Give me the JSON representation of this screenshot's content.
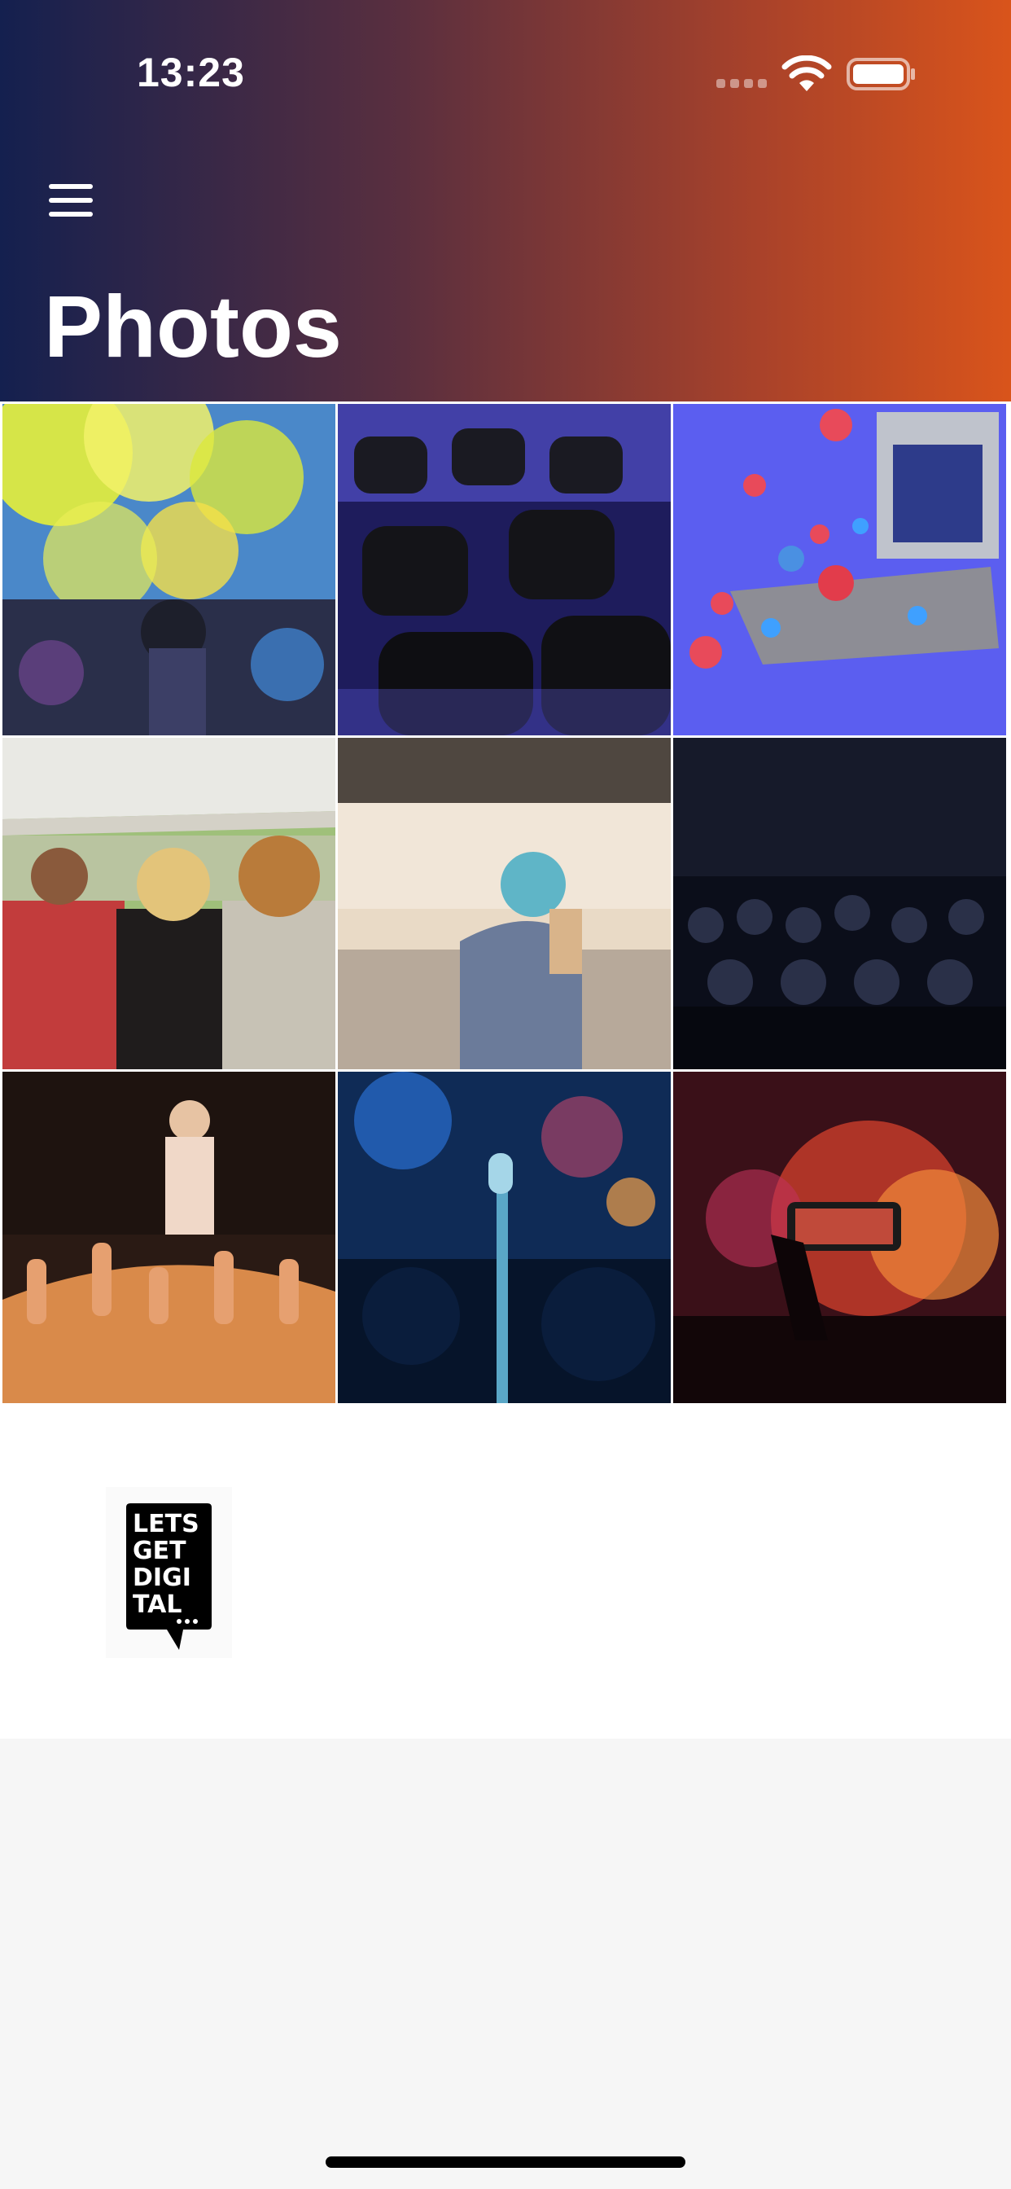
{
  "status_bar": {
    "time": "13:23",
    "icons": [
      "signal-dots-icon",
      "wifi-icon",
      "battery-icon"
    ]
  },
  "header": {
    "menu_icon": "hamburger-menu-icon",
    "title": "Photos"
  },
  "photos": [
    {
      "id": 1,
      "subject": "color powder festival crowd"
    },
    {
      "id": 2,
      "subject": "empty conference chairs in blue light"
    },
    {
      "id": 3,
      "subject": "social reaction hearts and likes with stage"
    },
    {
      "id": 4,
      "subject": "festival crowd under white tent"
    },
    {
      "id": 5,
      "subject": "woman with blue hair in conference hall"
    },
    {
      "id": 6,
      "subject": "audience in dark auditorium"
    },
    {
      "id": 7,
      "subject": "crowd raising hands at concert"
    },
    {
      "id": 8,
      "subject": "microphone on stage with blue lights"
    },
    {
      "id": 9,
      "subject": "phone recording concert lights"
    }
  ],
  "logo": {
    "text_lines": [
      "LETS",
      "GET",
      "DIGI",
      "TAL"
    ]
  },
  "colors": {
    "gradient_start": "#14204f",
    "gradient_end": "#d9541b",
    "background": "#f6f6f6"
  }
}
